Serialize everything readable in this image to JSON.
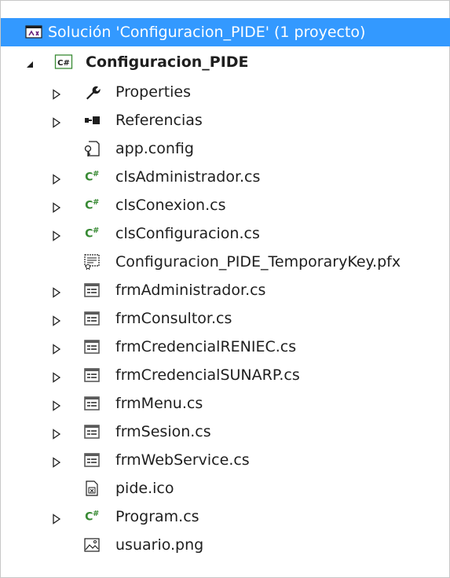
{
  "solution": {
    "label": "Solución 'Configuracion_PIDE'  (1 proyecto)"
  },
  "project": {
    "name": "Configuracion_PIDE",
    "icon": "csharp-project-icon"
  },
  "items": [
    {
      "label": "Properties",
      "icon": "wrench-icon",
      "expandable": true
    },
    {
      "label": "Referencias",
      "icon": "references-icon",
      "expandable": true
    },
    {
      "label": "app.config",
      "icon": "config-file-icon",
      "expandable": false
    },
    {
      "label": "clsAdministrador.cs",
      "icon": "csharp-file-icon",
      "expandable": true
    },
    {
      "label": "clsConexion.cs",
      "icon": "csharp-file-icon",
      "expandable": true
    },
    {
      "label": "clsConfiguracion.cs",
      "icon": "csharp-file-icon",
      "expandable": true
    },
    {
      "label": "Configuracion_PIDE_TemporaryKey.pfx",
      "icon": "certificate-key-icon",
      "expandable": false
    },
    {
      "label": "frmAdministrador.cs",
      "icon": "form-icon",
      "expandable": true
    },
    {
      "label": "frmConsultor.cs",
      "icon": "form-icon",
      "expandable": true
    },
    {
      "label": "frmCredencialRENIEC.cs",
      "icon": "form-icon",
      "expandable": true
    },
    {
      "label": "frmCredencialSUNARP.cs",
      "icon": "form-icon",
      "expandable": true
    },
    {
      "label": "frmMenu.cs",
      "icon": "form-icon",
      "expandable": true
    },
    {
      "label": "frmSesion.cs",
      "icon": "form-icon",
      "expandable": true
    },
    {
      "label": "frmWebService.cs",
      "icon": "form-icon",
      "expandable": true
    },
    {
      "label": "pide.ico",
      "icon": "icon-file-icon",
      "expandable": false
    },
    {
      "label": "Program.cs",
      "icon": "csharp-file-icon",
      "expandable": true
    },
    {
      "label": "usuario.png",
      "icon": "image-file-icon",
      "expandable": false
    }
  ],
  "colors": {
    "selection": "#3399ff",
    "csharp_green": "#388a34",
    "expander": "#1e1e1e",
    "form_icon": "#5a5a5a"
  }
}
